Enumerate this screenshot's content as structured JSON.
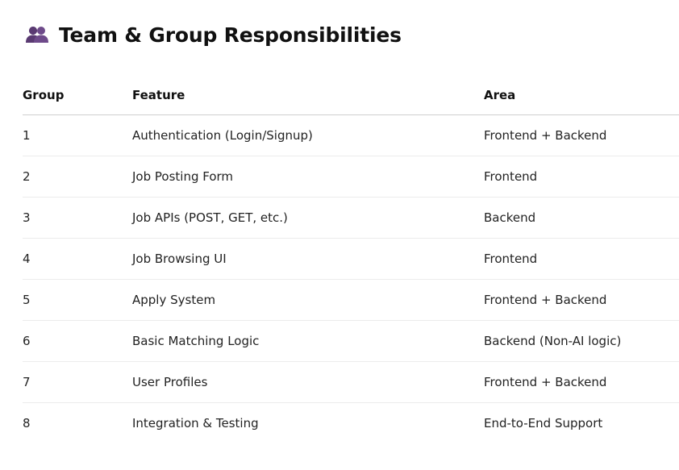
{
  "page": {
    "title": "Team & Group Responsibilities",
    "title_icon": "people-icon"
  },
  "table": {
    "headers": {
      "group": "Group",
      "feature": "Feature",
      "area": "Area"
    },
    "rows": [
      {
        "group": "1",
        "feature": "Authentication (Login/Signup)",
        "area": "Frontend + Backend"
      },
      {
        "group": "2",
        "feature": "Job Posting Form",
        "area": "Frontend"
      },
      {
        "group": "3",
        "feature": "Job APIs (POST, GET, etc.)",
        "area": "Backend"
      },
      {
        "group": "4",
        "feature": "Job Browsing UI",
        "area": "Frontend"
      },
      {
        "group": "5",
        "feature": "Apply System",
        "area": "Frontend + Backend"
      },
      {
        "group": "6",
        "feature": "Basic Matching Logic",
        "area": "Backend (Non-AI logic)"
      },
      {
        "group": "7",
        "feature": "User Profiles",
        "area": "Frontend + Backend"
      },
      {
        "group": "8",
        "feature": "Integration & Testing",
        "area": "End-to-End Support"
      }
    ]
  },
  "colors": {
    "icon": "#5a3a72",
    "text": "#1f1f1f",
    "header_rule": "#cfcfcf",
    "row_rule": "#ececec"
  }
}
